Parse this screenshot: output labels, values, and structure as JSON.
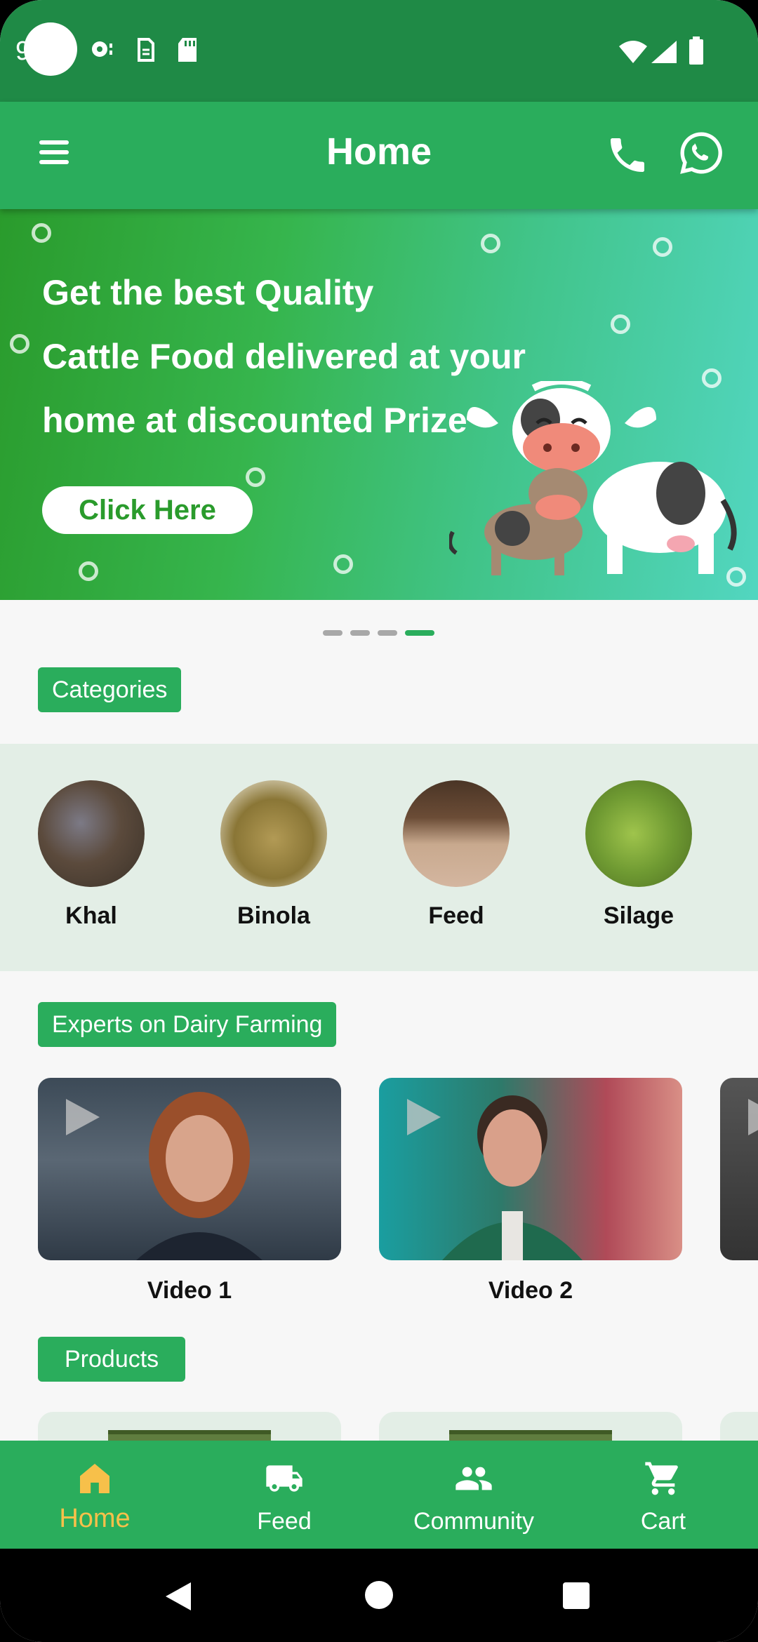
{
  "status_bar": {
    "time": "9"
  },
  "app_bar": {
    "title": "Home"
  },
  "banner": {
    "lines": [
      "Get the best Quality",
      "Cattle Food delivered at your",
      "home at discounted Prize"
    ],
    "button_label": "Click Here"
  },
  "carousel": {
    "pages": 4,
    "active_index": 3
  },
  "sections": {
    "categories": "Categories",
    "experts": "Experts on Dairy Farming",
    "products": "Products"
  },
  "categories": [
    {
      "label": "Khal"
    },
    {
      "label": "Binola"
    },
    {
      "label": "Feed"
    },
    {
      "label": "Silage"
    }
  ],
  "videos": [
    {
      "label": "Video 1"
    },
    {
      "label": "Video 2"
    }
  ],
  "bottom_nav": [
    {
      "label": "Home",
      "icon": "home-icon",
      "active": true
    },
    {
      "label": "Feed",
      "icon": "truck-icon",
      "active": false
    },
    {
      "label": "Community",
      "icon": "people-icon",
      "active": false
    },
    {
      "label": "Cart",
      "icon": "cart-icon",
      "active": false
    }
  ],
  "colors": {
    "primary": "#2aad5c",
    "status_bar": "#1f8a46",
    "active_nav": "#f7c04a",
    "category_strip": "#e3eee6"
  }
}
